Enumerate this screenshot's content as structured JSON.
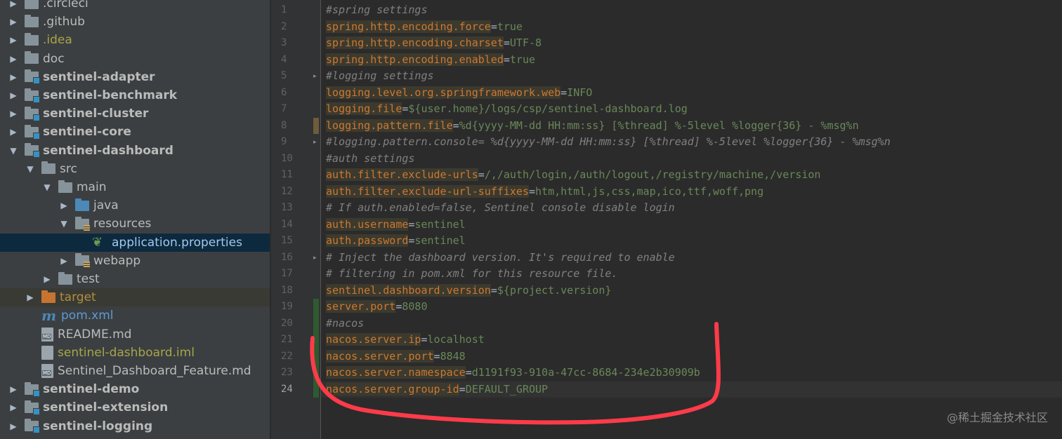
{
  "project_tree": {
    "items": [
      {
        "label": ".circleci",
        "arrow": "right",
        "icon": "folder-icon",
        "indent": 0,
        "style": "normal"
      },
      {
        "label": ".github",
        "arrow": "right",
        "icon": "folder-icon",
        "indent": 0,
        "style": "normal"
      },
      {
        "label": ".idea",
        "arrow": "right",
        "icon": "folder-icon",
        "indent": 0,
        "style": "olive"
      },
      {
        "label": "doc",
        "arrow": "right",
        "icon": "folder-icon",
        "indent": 0,
        "style": "normal"
      },
      {
        "label": "sentinel-adapter",
        "arrow": "right",
        "icon": "module-folder-icon",
        "indent": 0,
        "style": "bold"
      },
      {
        "label": "sentinel-benchmark",
        "arrow": "right",
        "icon": "module-folder-icon",
        "indent": 0,
        "style": "bold"
      },
      {
        "label": "sentinel-cluster",
        "arrow": "right",
        "icon": "module-folder-icon",
        "indent": 0,
        "style": "bold"
      },
      {
        "label": "sentinel-core",
        "arrow": "right",
        "icon": "module-folder-icon",
        "indent": 0,
        "style": "bold"
      },
      {
        "label": "sentinel-dashboard",
        "arrow": "down",
        "icon": "module-folder-icon",
        "indent": 0,
        "style": "bold"
      },
      {
        "label": "src",
        "arrow": "down",
        "icon": "folder-icon",
        "indent": 1,
        "style": "normal"
      },
      {
        "label": "main",
        "arrow": "down",
        "icon": "folder-icon",
        "indent": 2,
        "style": "normal"
      },
      {
        "label": "java",
        "arrow": "right",
        "icon": "source-folder-icon",
        "indent": 3,
        "style": "normal"
      },
      {
        "label": "resources",
        "arrow": "down",
        "icon": "resources-folder-icon",
        "indent": 3,
        "style": "normal"
      },
      {
        "label": "application.properties",
        "arrow": "none",
        "icon": "spring-properties-icon",
        "indent": 4,
        "style": "selected"
      },
      {
        "label": "webapp",
        "arrow": "right",
        "icon": "resources-folder-icon",
        "indent": 3,
        "style": "normal"
      },
      {
        "label": "test",
        "arrow": "right",
        "icon": "folder-icon",
        "indent": 2,
        "style": "normal"
      },
      {
        "label": "target",
        "arrow": "right",
        "icon": "excluded-folder-icon",
        "indent": 1,
        "style": "excluded"
      },
      {
        "label": "pom.xml",
        "arrow": "none",
        "icon": "maven-icon",
        "indent": 1,
        "style": "blue"
      },
      {
        "label": "README.md",
        "arrow": "none",
        "icon": "markdown-file-icon",
        "indent": 1,
        "style": "normal"
      },
      {
        "label": "sentinel-dashboard.iml",
        "arrow": "none",
        "icon": "iml-file-icon",
        "indent": 1,
        "style": "olive"
      },
      {
        "label": "Sentinel_Dashboard_Feature.md",
        "arrow": "none",
        "icon": "markdown-file-icon",
        "indent": 1,
        "style": "normal"
      },
      {
        "label": "sentinel-demo",
        "arrow": "right",
        "icon": "module-folder-icon",
        "indent": 0,
        "style": "bold"
      },
      {
        "label": "sentinel-extension",
        "arrow": "right",
        "icon": "module-folder-icon",
        "indent": 0,
        "style": "bold"
      },
      {
        "label": "sentinel-logging",
        "arrow": "right",
        "icon": "module-folder-icon",
        "indent": 0,
        "style": "bold"
      }
    ]
  },
  "icons": {
    "arrow_right": "▶",
    "arrow_down": "▼",
    "fold_marker": "▸",
    "md_tag": "MD"
  },
  "editor": {
    "current_line": 24,
    "lines": [
      {
        "n": "1",
        "type": "comment",
        "text": "#spring settings"
      },
      {
        "n": "2",
        "type": "kv",
        "key": "spring.http.encoding.force",
        "value": "true"
      },
      {
        "n": "3",
        "type": "kv",
        "key": "spring.http.encoding.charset",
        "value": "UTF-8"
      },
      {
        "n": "4",
        "type": "kv",
        "key": "spring.http.encoding.enabled",
        "value": "true"
      },
      {
        "n": "5",
        "type": "comment",
        "text": "#logging settings"
      },
      {
        "n": "6",
        "type": "kv",
        "key": "logging.level.org.springframework.web",
        "value": "INFO"
      },
      {
        "n": "7",
        "type": "kv",
        "key": "logging.file",
        "value": "${user.home}/logs/csp/sentinel-dashboard.log"
      },
      {
        "n": "8",
        "type": "kv",
        "key": "logging.pattern.file",
        "value": "%d{yyyy-MM-dd HH:mm:ss} [%thread] %-5level %logger{36} - %msg%n"
      },
      {
        "n": "9",
        "type": "comment",
        "text": "#logging.pattern.console= %d{yyyy-MM-dd HH:mm:ss} [%thread] %-5level %logger{36} - %msg%n"
      },
      {
        "n": "10",
        "type": "comment",
        "text": "#auth settings"
      },
      {
        "n": "11",
        "type": "kv",
        "key": "auth.filter.exclude-urls",
        "value": "/,/auth/login,/auth/logout,/registry/machine,/version"
      },
      {
        "n": "12",
        "type": "kv",
        "key": "auth.filter.exclude-url-suffixes",
        "value": "htm,html,js,css,map,ico,ttf,woff,png"
      },
      {
        "n": "13",
        "type": "comment",
        "text": "# If auth.enabled=false, Sentinel console disable login"
      },
      {
        "n": "14",
        "type": "kv",
        "key": "auth.username",
        "value": "sentinel"
      },
      {
        "n": "15",
        "type": "kv",
        "key": "auth.password",
        "value": "sentinel"
      },
      {
        "n": "16",
        "type": "comment",
        "text": "# Inject the dashboard version. It's required to enable"
      },
      {
        "n": "17",
        "type": "comment",
        "text": "# filtering in pom.xml for this resource file."
      },
      {
        "n": "18",
        "type": "kv",
        "key": "sentinel.dashboard.version",
        "value": "${project.version}"
      },
      {
        "n": "19",
        "type": "kv",
        "key": "server.port",
        "value": "8080"
      },
      {
        "n": "20",
        "type": "comment",
        "text": "#nacos"
      },
      {
        "n": "21",
        "type": "kv",
        "key": "nacos.server.ip",
        "value": "localhost"
      },
      {
        "n": "22",
        "type": "kv",
        "key": "nacos.server.port",
        "value": "8848"
      },
      {
        "n": "23",
        "type": "kv",
        "key": "nacos.server.namespace",
        "value": "d1191f93-910a-47cc-8684-234e2b30909b"
      },
      {
        "n": "24",
        "type": "kv",
        "key": "nacos.server.group-id",
        "value": "DEFAULT_GROUP"
      }
    ]
  },
  "watermark": "@稀土掘金技术社区",
  "colors": {
    "annotation_stroke": "#ff3b4a",
    "added_line_marker": "#2f5a2f",
    "modified_line_marker": "#6e5c3a"
  }
}
